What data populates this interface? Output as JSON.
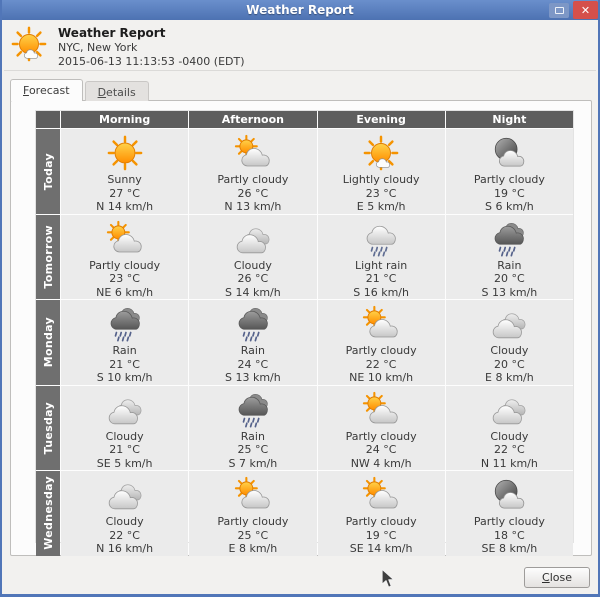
{
  "window": {
    "title": "Weather Report",
    "colors": {
      "titlebar": "#5176b8",
      "close_button": "#d5504b",
      "table_header": "#5e5e5e",
      "row_label": "#6f6f6f",
      "cell_bg": "#ebebeb"
    }
  },
  "header": {
    "title": "Weather Report",
    "location": "NYC, New York",
    "timestamp": "2015-06-13 11:13:53 -0400 (EDT)",
    "icon": "lightly-cloudy-day"
  },
  "tabs": [
    {
      "label": "Forecast",
      "active": true
    },
    {
      "label": "Details",
      "active": false
    }
  ],
  "forecast": {
    "columns": [
      "Morning",
      "Afternoon",
      "Evening",
      "Night"
    ],
    "rows": [
      {
        "label": "Today",
        "cells": [
          {
            "icon": "sunny",
            "condition": "Sunny",
            "temp": "27 °C",
            "wind": "N 14 km/h"
          },
          {
            "icon": "partly-cloudy-day",
            "condition": "Partly cloudy",
            "temp": "26 °C",
            "wind": "N 13 km/h"
          },
          {
            "icon": "lightly-cloudy-day",
            "condition": "Lightly cloudy",
            "temp": "23 °C",
            "wind": "E 5 km/h"
          },
          {
            "icon": "partly-cloudy-night",
            "condition": "Partly cloudy",
            "temp": "19 °C",
            "wind": "S 6 km/h"
          }
        ]
      },
      {
        "label": "Tomorrow",
        "cells": [
          {
            "icon": "partly-cloudy-day",
            "condition": "Partly cloudy",
            "temp": "23 °C",
            "wind": "NE 6 km/h"
          },
          {
            "icon": "cloudy",
            "condition": "Cloudy",
            "temp": "26 °C",
            "wind": "S 14 km/h"
          },
          {
            "icon": "light-rain",
            "condition": "Light rain",
            "temp": "21 °C",
            "wind": "S 16 km/h"
          },
          {
            "icon": "rain",
            "condition": "Rain",
            "temp": "20 °C",
            "wind": "S 13 km/h"
          }
        ]
      },
      {
        "label": "Monday",
        "cells": [
          {
            "icon": "rain",
            "condition": "Rain",
            "temp": "21 °C",
            "wind": "S 10 km/h"
          },
          {
            "icon": "rain",
            "condition": "Rain",
            "temp": "24 °C",
            "wind": "S 13 km/h"
          },
          {
            "icon": "partly-cloudy-day",
            "condition": "Partly cloudy",
            "temp": "22 °C",
            "wind": "NE 10 km/h"
          },
          {
            "icon": "cloudy",
            "condition": "Cloudy",
            "temp": "20 °C",
            "wind": "E 8 km/h"
          }
        ]
      },
      {
        "label": "Tuesday",
        "cells": [
          {
            "icon": "cloudy",
            "condition": "Cloudy",
            "temp": "21 °C",
            "wind": "SE 5 km/h"
          },
          {
            "icon": "rain",
            "condition": "Rain",
            "temp": "25 °C",
            "wind": "S 7 km/h"
          },
          {
            "icon": "partly-cloudy-day",
            "condition": "Partly cloudy",
            "temp": "24 °C",
            "wind": "NW 4 km/h"
          },
          {
            "icon": "cloudy",
            "condition": "Cloudy",
            "temp": "22 °C",
            "wind": "N 11 km/h"
          }
        ]
      },
      {
        "label": "Wednesday",
        "cells": [
          {
            "icon": "cloudy",
            "condition": "Cloudy",
            "temp": "22 °C",
            "wind": "N 16 km/h"
          },
          {
            "icon": "partly-cloudy-day",
            "condition": "Partly cloudy",
            "temp": "25 °C",
            "wind": "E 8 km/h"
          },
          {
            "icon": "partly-cloudy-day",
            "condition": "Partly cloudy",
            "temp": "19 °C",
            "wind": "SE 14 km/h"
          },
          {
            "icon": "partly-cloudy-night",
            "condition": "Partly cloudy",
            "temp": "18 °C",
            "wind": "SE 8 km/h"
          }
        ]
      }
    ]
  },
  "footer": {
    "close_label": "Close"
  }
}
